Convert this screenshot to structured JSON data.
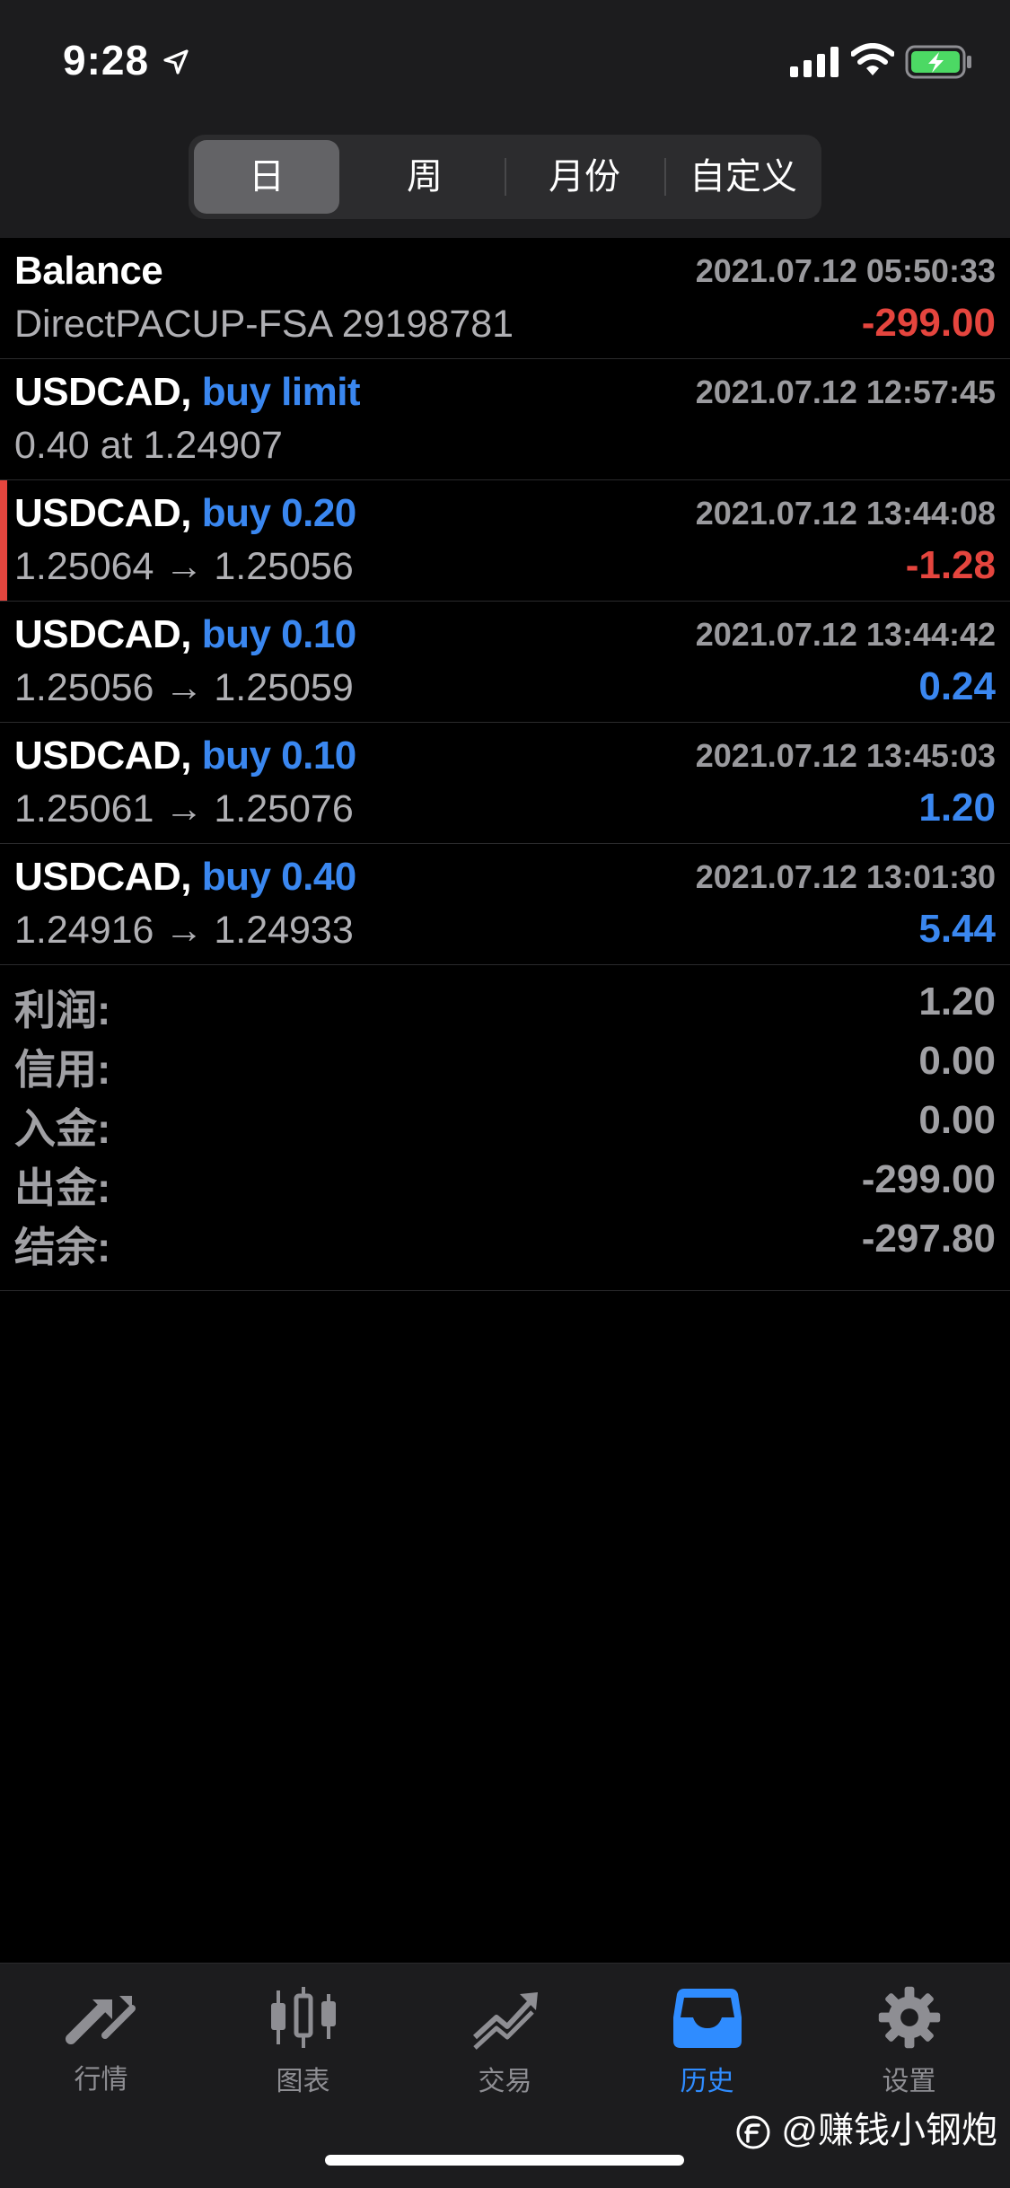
{
  "status_bar": {
    "time": "9:28",
    "icons": [
      "location-arrow-icon",
      "cellular-signal-icon",
      "wifi-icon",
      "battery-charging-icon"
    ],
    "battery_color": "#4cd964"
  },
  "segmented_control": {
    "segments": [
      "日",
      "周",
      "月份",
      "自定义"
    ],
    "selected_index": 0
  },
  "colors": {
    "accent_blue": "#3a87f0",
    "loss_red": "#e5453e",
    "muted_gray": "#9a9a9e"
  },
  "history": [
    {
      "symbol": "Balance",
      "action": "",
      "time": "2021.07.12 05:50:33",
      "detail": "DirectPACUP-FSA 29198781",
      "amount": "-299.00",
      "amount_type": "neg"
    },
    {
      "symbol": "USDCAD,",
      "action": "buy limit",
      "time": "2021.07.12 12:57:45",
      "detail": "0.40 at 1.24907",
      "amount": "",
      "amount_type": ""
    },
    {
      "symbol": "USDCAD,",
      "action": "buy 0.20",
      "time": "2021.07.12 13:44:08",
      "detail": "1.25064 → 1.25056",
      "amount": "-1.28",
      "amount_type": "neg",
      "marked": true
    },
    {
      "symbol": "USDCAD,",
      "action": "buy 0.10",
      "time": "2021.07.12 13:44:42",
      "detail": "1.25056 → 1.25059",
      "amount": "0.24",
      "amount_type": "pos"
    },
    {
      "symbol": "USDCAD,",
      "action": "buy 0.10",
      "time": "2021.07.12 13:45:03",
      "detail": "1.25061 → 1.25076",
      "amount": "1.20",
      "amount_type": "pos"
    },
    {
      "symbol": "USDCAD,",
      "action": "buy 0.40",
      "time": "2021.07.12 13:01:30",
      "detail": "1.24916 → 1.24933",
      "amount": "5.44",
      "amount_type": "pos"
    }
  ],
  "summary": [
    {
      "label": "利润:",
      "value": "1.20"
    },
    {
      "label": "信用:",
      "value": "0.00"
    },
    {
      "label": "入金:",
      "value": "0.00"
    },
    {
      "label": "出金:",
      "value": "-299.00"
    },
    {
      "label": "结余:",
      "value": "-297.80"
    }
  ],
  "tabbar": {
    "tabs": [
      {
        "label": "行情",
        "icon": "quotes-arrows-icon"
      },
      {
        "label": "图表",
        "icon": "candlestick-chart-icon"
      },
      {
        "label": "交易",
        "icon": "trade-trend-icon"
      },
      {
        "label": "历史",
        "icon": "history-inbox-icon"
      },
      {
        "label": "设置",
        "icon": "settings-gear-icon"
      }
    ],
    "selected_index": 3
  },
  "watermark": {
    "text": "@赚钱小钢炮",
    "icon": "weibo-logo-icon"
  }
}
